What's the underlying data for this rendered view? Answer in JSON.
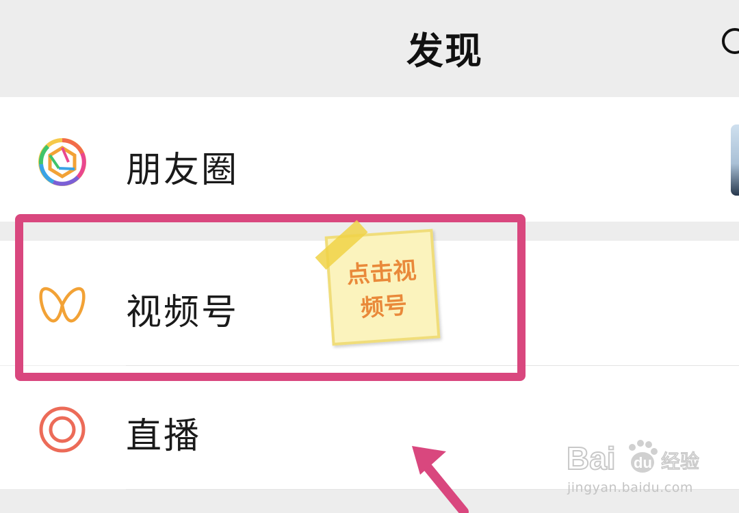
{
  "header": {
    "title": "发现"
  },
  "menu": {
    "items": [
      {
        "label": "朋友圈",
        "icon": "moments-aperture-icon"
      },
      {
        "label": "视频号",
        "icon": "channels-butterfly-icon"
      },
      {
        "label": "直播",
        "icon": "live-ring-icon"
      }
    ]
  },
  "annotation": {
    "note_line1": "点击视",
    "note_line2": "频号",
    "highlight_color": "#d9477e",
    "note_text_color": "#e9893a"
  },
  "watermark": {
    "logo": "Baidu经验",
    "url": "jingyan.baidu.com"
  }
}
